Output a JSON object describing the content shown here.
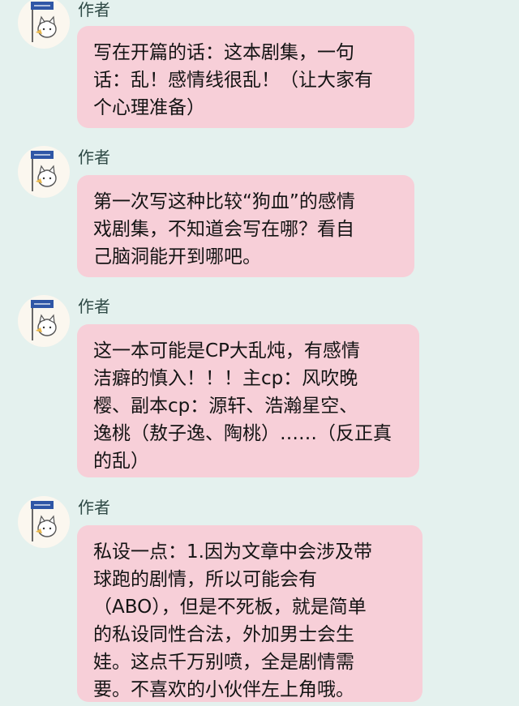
{
  "messages": [
    {
      "author": "作者",
      "text": "写在开篇的话：这本剧集，一句\n话：乱！感情线很乱！（让大家有\n个心理准备）"
    },
    {
      "author": "作者",
      "text": "第一次写这种比较“狗血”的感情\n戏剧集，不知道会写在哪？看自\n己脑洞能开到哪吧。"
    },
    {
      "author": "作者",
      "text": "这一本可能是CP大乱炖，有感情\n洁癖的慎入！！！主cp：风吹晚\n樱、副本cp：源轩、浩瀚星空、\n逸桃（敖子逸、陶桃）……（反正真\n的乱）"
    },
    {
      "author": "作者",
      "text": "私设一点：1.因为文章中会涉及带\n球跑的剧情，所以可能会有\n（ABO），但是不死板，就是简单\n的私设同性合法，外加男士会生\n娃。这点千万别喷，全是剧情需\n要。不喜欢的小伙伴左上角哦。"
    }
  ],
  "avatar_icon": "cat-with-sign-icon",
  "colors": {
    "background": "#e4f1ee",
    "bubble": "#f7cfd8",
    "text": "#141414",
    "author": "#2f4a46"
  }
}
